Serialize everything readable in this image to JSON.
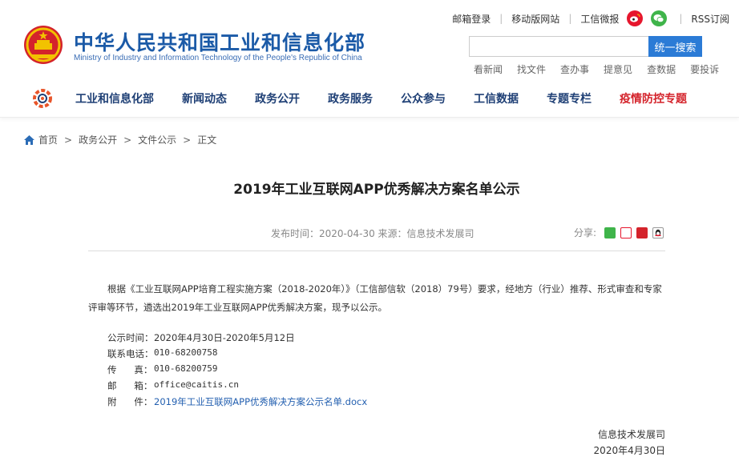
{
  "header": {
    "title": "中华人民共和国工业和信息化部",
    "subtitle": "Ministry of Industry and Information Technology of the People's Republic of China",
    "toplinks": {
      "mailbox": "邮箱登录",
      "mobile": "移动版网站",
      "weibo": "工信微报",
      "rss": "RSS订阅"
    },
    "search": {
      "placeholder": "",
      "button": "统一搜索"
    },
    "quicklinks": [
      "看新闻",
      "找文件",
      "查办事",
      "提意见",
      "查数据",
      "要投诉"
    ]
  },
  "nav": {
    "items": [
      "工业和信息化部",
      "新闻动态",
      "政务公开",
      "政务服务",
      "公众参与",
      "工信数据",
      "专题专栏",
      "疫情防控专题"
    ]
  },
  "breadcrumb": {
    "home": "首页",
    "level1": "政务公开",
    "level2": "文件公示",
    "current": "正文",
    "separator": ">"
  },
  "article": {
    "title": "2019年工业互联网APP优秀解决方案名单公示",
    "meta": "发布时间：2020-04-30 来源：信息技术发展司",
    "share_label": "分享:",
    "body": "根据《工业互联网APP培育工程实施方案（2018-2020年）》（工信部信软（2018）79号）要求，经地方（行业）推荐、形式审查和专家评审等环节，遴选出2019年工业互联网APP优秀解决方案，现予以公示。",
    "info": [
      {
        "label": "公示时间：",
        "value": "2020年4月30日-2020年5月12日"
      },
      {
        "label": "联系电话：",
        "value": "010-68200758"
      },
      {
        "label": "传      真：",
        "value": "010-68200759"
      },
      {
        "label": "邮      箱：",
        "value": "office@caitis.cn"
      },
      {
        "label": "附      件：",
        "value": "2019年工业互联网APP优秀解决方案公示名单.docx"
      }
    ],
    "signoff_org": "信息技术发展司",
    "signoff_date": "2020年4月30日"
  },
  "colors": {
    "brand_blue": "#1b5aa7",
    "nav_text": "#1e3f75",
    "highlight_red": "#d4232b",
    "search_button": "#2b7bd6",
    "link_blue": "#2460b0"
  },
  "icons": [
    "national-emblem-icon",
    "weibo-icon",
    "wechat-icon",
    "nav-logo-icon",
    "home-icon",
    "share-wechat-icon",
    "share-weibo-icon",
    "share-red-icon",
    "share-qq-icon"
  ]
}
